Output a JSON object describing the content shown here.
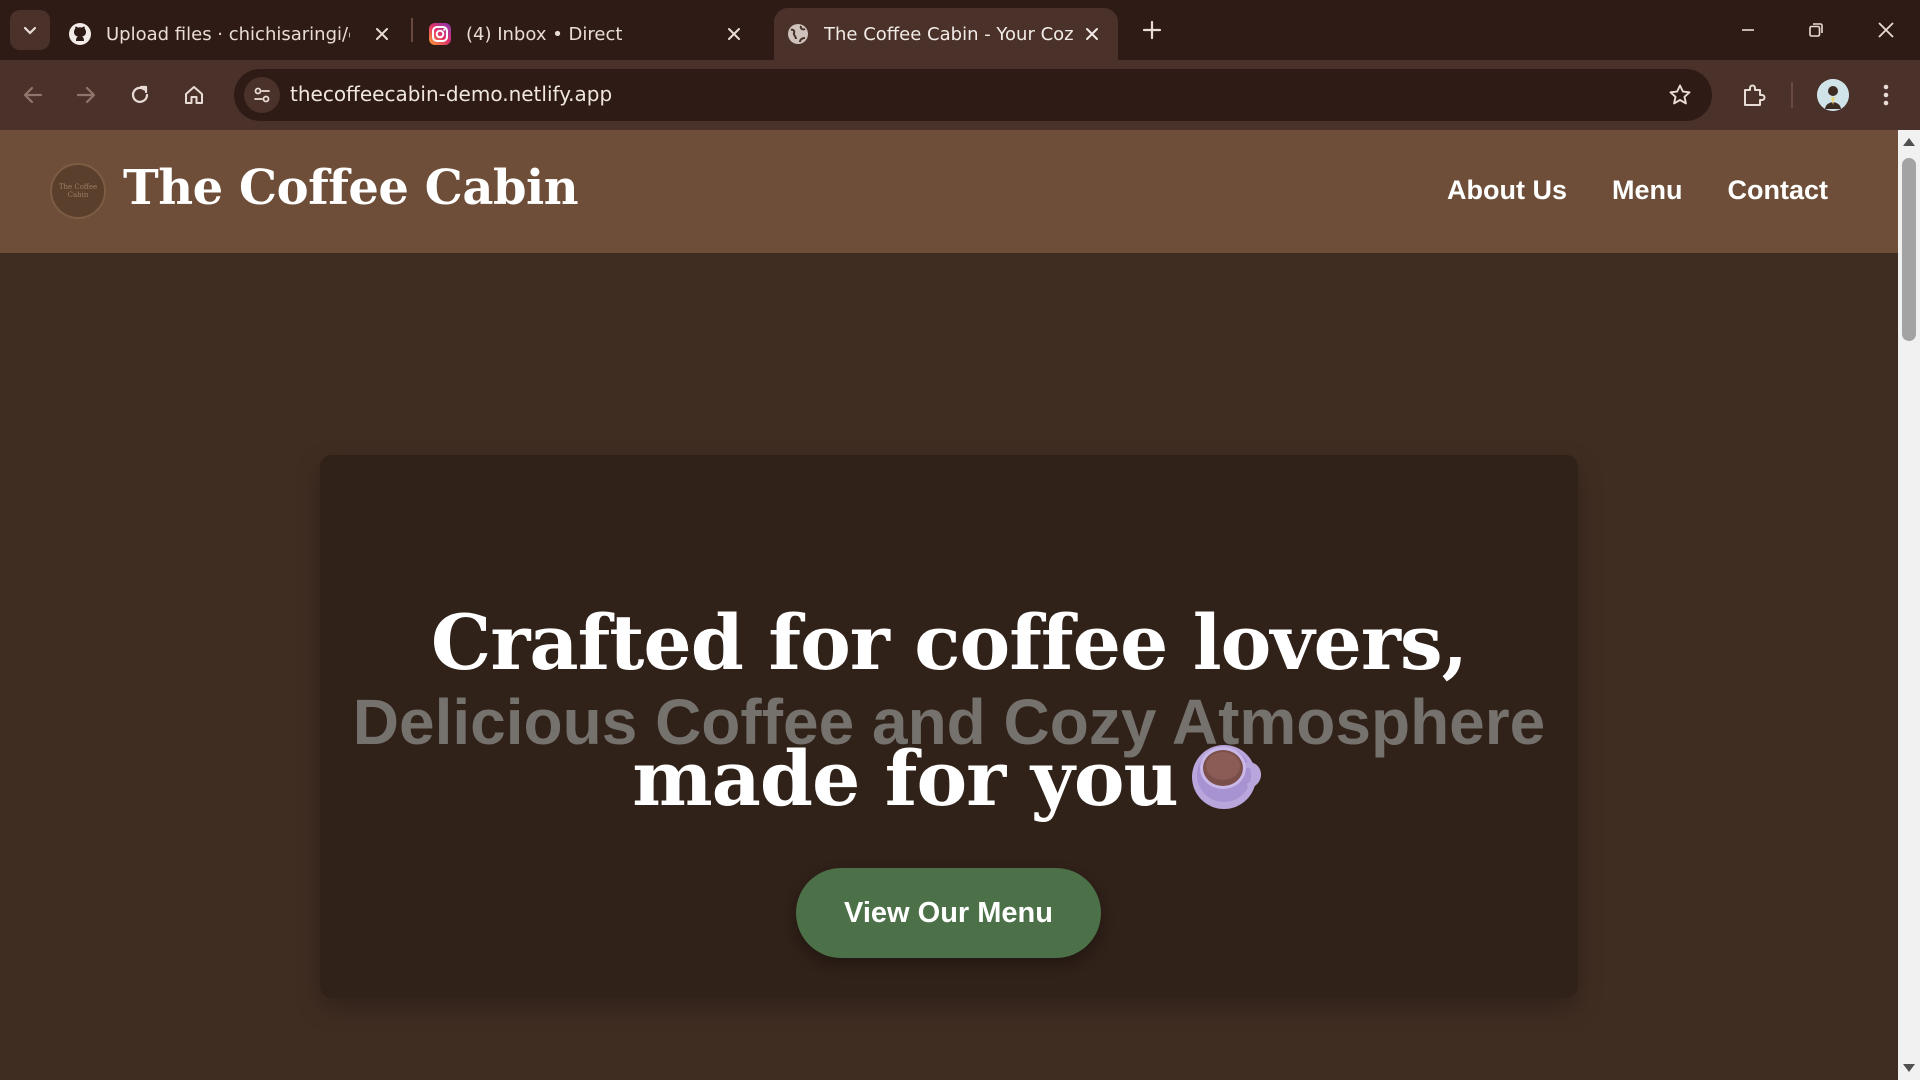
{
  "browser": {
    "tabs": [
      {
        "title": "Upload files · chichisaringi/cafe",
        "favicon": "github-icon",
        "active": false
      },
      {
        "title": "(4) Inbox • Direct",
        "favicon": "instagram-icon",
        "active": false
      },
      {
        "title": "The Coffee Cabin - Your Cozy R",
        "favicon": "globe-icon",
        "active": true
      }
    ],
    "url": "thecoffeecabin-demo.netlify.app"
  },
  "site": {
    "title": "The Coffee Cabin",
    "logo_text": "The Coffee Cabin",
    "nav": [
      "About Us",
      "Menu",
      "Contact"
    ]
  },
  "hero": {
    "title": "Crafted for coffee lovers, made for you",
    "subtitle": "Delicious Coffee and Cozy Atmosphere",
    "emoji": "coffee-cup-icon",
    "cta_label": "View Our Menu"
  },
  "colors": {
    "header_bg": "#6e4e38",
    "page_bg": "#402d22",
    "card_bg": "#302119",
    "cta_bg": "#4c7048"
  }
}
